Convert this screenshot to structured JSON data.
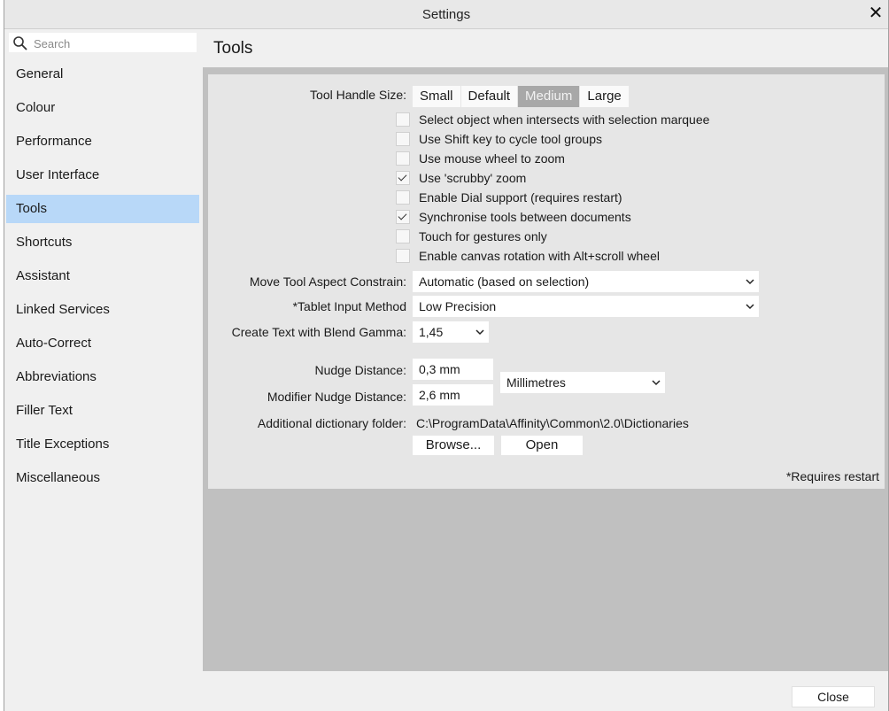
{
  "window": {
    "title": "Settings"
  },
  "search": {
    "placeholder": "Search"
  },
  "sidebar": {
    "items": [
      {
        "label": "General"
      },
      {
        "label": "Colour"
      },
      {
        "label": "Performance"
      },
      {
        "label": "User Interface"
      },
      {
        "label": "Tools",
        "selected": true
      },
      {
        "label": "Shortcuts"
      },
      {
        "label": "Assistant"
      },
      {
        "label": "Linked Services"
      },
      {
        "label": "Auto-Correct"
      },
      {
        "label": "Abbreviations"
      },
      {
        "label": "Filler Text"
      },
      {
        "label": "Title Exceptions"
      },
      {
        "label": "Miscellaneous"
      }
    ]
  },
  "main": {
    "title": "Tools",
    "tool_handle": {
      "label": "Tool Handle Size:",
      "options": [
        "Small",
        "Default",
        "Medium",
        "Large"
      ],
      "selected": "Medium"
    },
    "checkboxes": [
      {
        "label": "Select object when intersects with selection marquee",
        "checked": false
      },
      {
        "label": "Use Shift key to cycle tool groups",
        "checked": false
      },
      {
        "label": "Use mouse wheel to zoom",
        "checked": false
      },
      {
        "label": "Use 'scrubby' zoom",
        "checked": true
      },
      {
        "label": "Enable Dial support (requires restart)",
        "checked": false
      },
      {
        "label": "Synchronise tools between documents",
        "checked": true
      },
      {
        "label": "Touch for gestures only",
        "checked": false
      },
      {
        "label": "Enable canvas rotation with Alt+scroll wheel",
        "checked": false
      }
    ],
    "move_tool": {
      "label": "Move Tool Aspect Constrain:",
      "value": "Automatic (based on selection)"
    },
    "tablet": {
      "label": "*Tablet Input Method",
      "value": "Low Precision"
    },
    "blend_gamma": {
      "label": "Create Text with Blend Gamma:",
      "value": "1,45"
    },
    "nudge": {
      "label": "Nudge Distance:",
      "value": "0,3 mm"
    },
    "modifier_nudge": {
      "label": "Modifier Nudge Distance:",
      "value": "2,6 mm"
    },
    "units": {
      "value": "Millimetres"
    },
    "dictionary": {
      "label": "Additional dictionary folder:",
      "path": "C:\\ProgramData\\Affinity\\Common\\2.0\\Dictionaries",
      "browse_label": "Browse...",
      "open_label": "Open"
    },
    "restart_note": "*Requires restart"
  },
  "footer": {
    "close_label": "Close"
  },
  "colors": {
    "selected_nav": "#b8d8f8",
    "selected_segment": "#a8a8a8",
    "panel": "#e6e6e6",
    "empty_area": "#c0c0c0"
  }
}
